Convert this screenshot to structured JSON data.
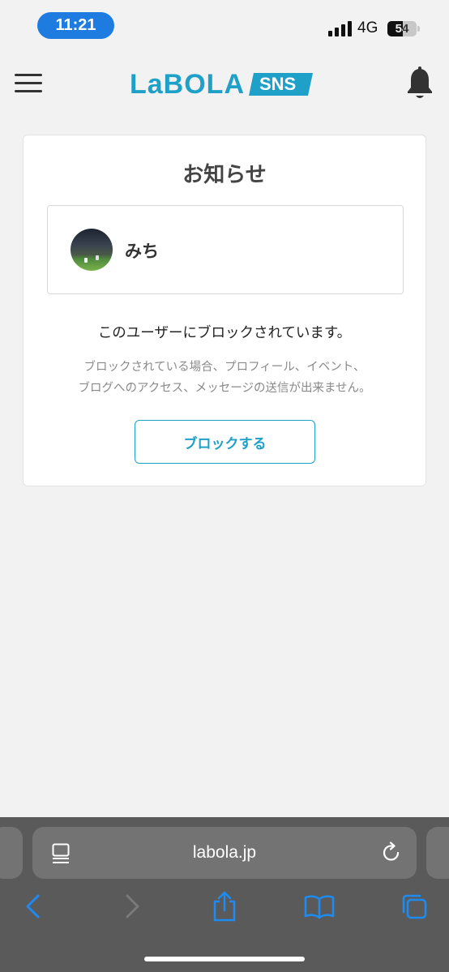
{
  "status_bar": {
    "time": "11:21",
    "network": "4G",
    "battery": "54",
    "battery_level": 0.54
  },
  "header": {
    "logo_text": "LaBOLA",
    "logo_badge": "SNS",
    "brand_color": "#1ea0c8"
  },
  "notice": {
    "title": "お知らせ",
    "user_name": "みち",
    "blocked_message": "このユーザーにブロックされています。",
    "description_line1": "ブロックされている場合、プロフィール、イベント、",
    "description_line2": "ブログへのアクセス、メッセージの送信が出来ません。",
    "block_button_label": "ブロックする"
  },
  "browser": {
    "url": "labola.jp",
    "icons": [
      "page-menu-icon",
      "reload-icon",
      "back-icon",
      "forward-icon",
      "share-icon",
      "bookmarks-icon",
      "tabs-icon"
    ]
  }
}
